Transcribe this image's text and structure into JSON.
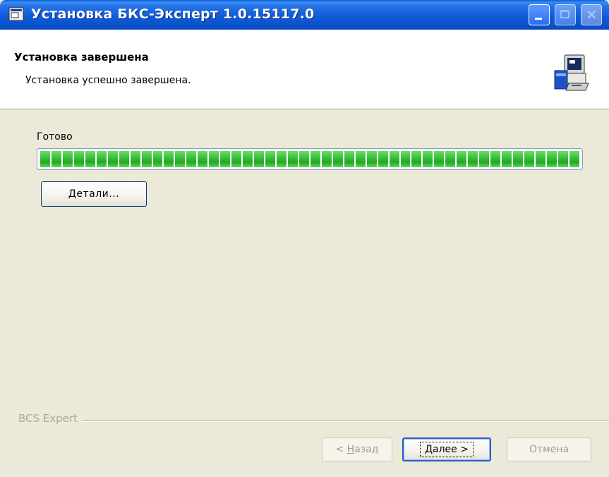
{
  "window": {
    "title": "Установка БКС-Эксперт 1.0.15117.0"
  },
  "header": {
    "title": "Установка завершена",
    "subtitle": "Установка успешно завершена."
  },
  "progress": {
    "status_label": "Готово",
    "value_percent": 100,
    "segments": 48,
    "color": "#3ec43e"
  },
  "details_button": {
    "mnemonic": "Д",
    "rest": "етали..."
  },
  "branding": "BCS Expert",
  "footer": {
    "back": {
      "prefix": "< ",
      "mnemonic": "Н",
      "rest": "азад"
    },
    "next": {
      "mnemonic": "Д",
      "rest": "алее >"
    },
    "cancel": "Отмена"
  }
}
